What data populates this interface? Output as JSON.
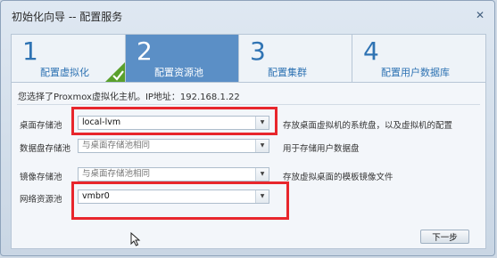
{
  "window": {
    "title": "初始化向导 -- 配置服务"
  },
  "steps": [
    {
      "number": "1",
      "label": "配置虚拟化",
      "state": "done"
    },
    {
      "number": "2",
      "label": "配置资源池",
      "state": "active"
    },
    {
      "number": "3",
      "label": "配置集群",
      "state": "pending"
    },
    {
      "number": "4",
      "label": "配置用户数据库",
      "state": "pending"
    }
  ],
  "info_text": "您选择了Proxmox虚拟化主机。IP地址：192.168.1.22",
  "fields": {
    "desktop_storage": {
      "label": "桌面存储池",
      "value": "local-lvm",
      "desc": "存放桌面虚拟机的系统盘，以及虚拟机的配置"
    },
    "data_disk_storage": {
      "label": "数据盘存储池",
      "value": "与桌面存储池相同",
      "desc": "用于存储用户数据盘"
    },
    "image_storage": {
      "label": "镜像存储池",
      "value": "与桌面存储池相同",
      "desc": "存放虚拟桌面的模板镜像文件"
    },
    "network_pool": {
      "label": "网络资源池",
      "value": "vmbr0"
    }
  },
  "buttons": {
    "next": "下一步"
  },
  "colors": {
    "accent": "#5b8fc6",
    "highlight": "#e8262c",
    "step_text": "#2f73b3"
  }
}
